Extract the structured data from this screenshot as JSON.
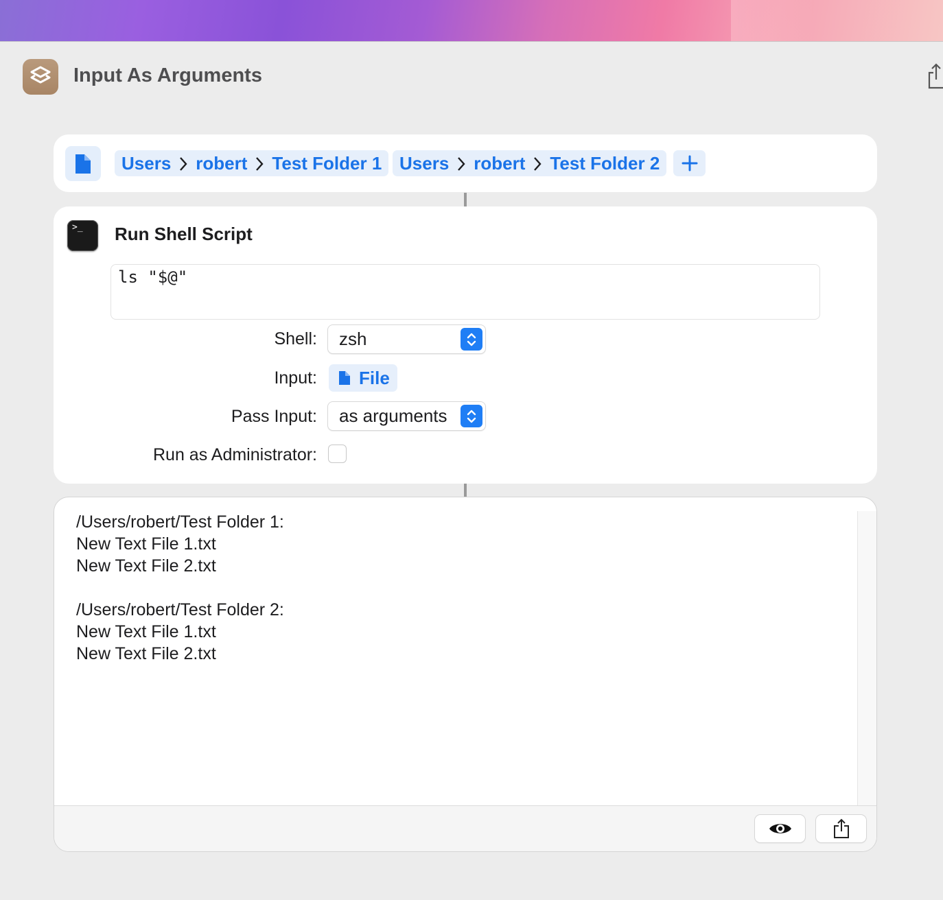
{
  "window": {
    "title": "Input As Arguments"
  },
  "colors": {
    "accent": "#1a73e8",
    "app_icon": "#b0906f"
  },
  "input_card": {
    "file_icon": "document-icon",
    "paths": [
      {
        "parts": [
          "Users",
          "robert",
          "Test Folder 1"
        ]
      },
      {
        "parts": [
          "Users",
          "robert",
          "Test Folder 2"
        ]
      }
    ],
    "add_icon": "plus-icon"
  },
  "action": {
    "title": "Run Shell Script",
    "icon": "terminal-icon",
    "prompt_glyph": ">_",
    "script": "ls \"$@\"",
    "shell_label": "Shell:",
    "shell_value": "zsh",
    "input_label": "Input:",
    "input_value": "File",
    "pass_input_label": "Pass Input:",
    "pass_input_value": "as arguments",
    "admin_label": "Run as Administrator:",
    "admin_checked": false
  },
  "output": {
    "text": "/Users/robert/Test Folder 1:\nNew Text File 1.txt\nNew Text File 2.txt\n\n/Users/robert/Test Folder 2:\nNew Text File 1.txt\nNew Text File 2.txt",
    "buttons": [
      "eye-icon",
      "share-icon"
    ]
  }
}
